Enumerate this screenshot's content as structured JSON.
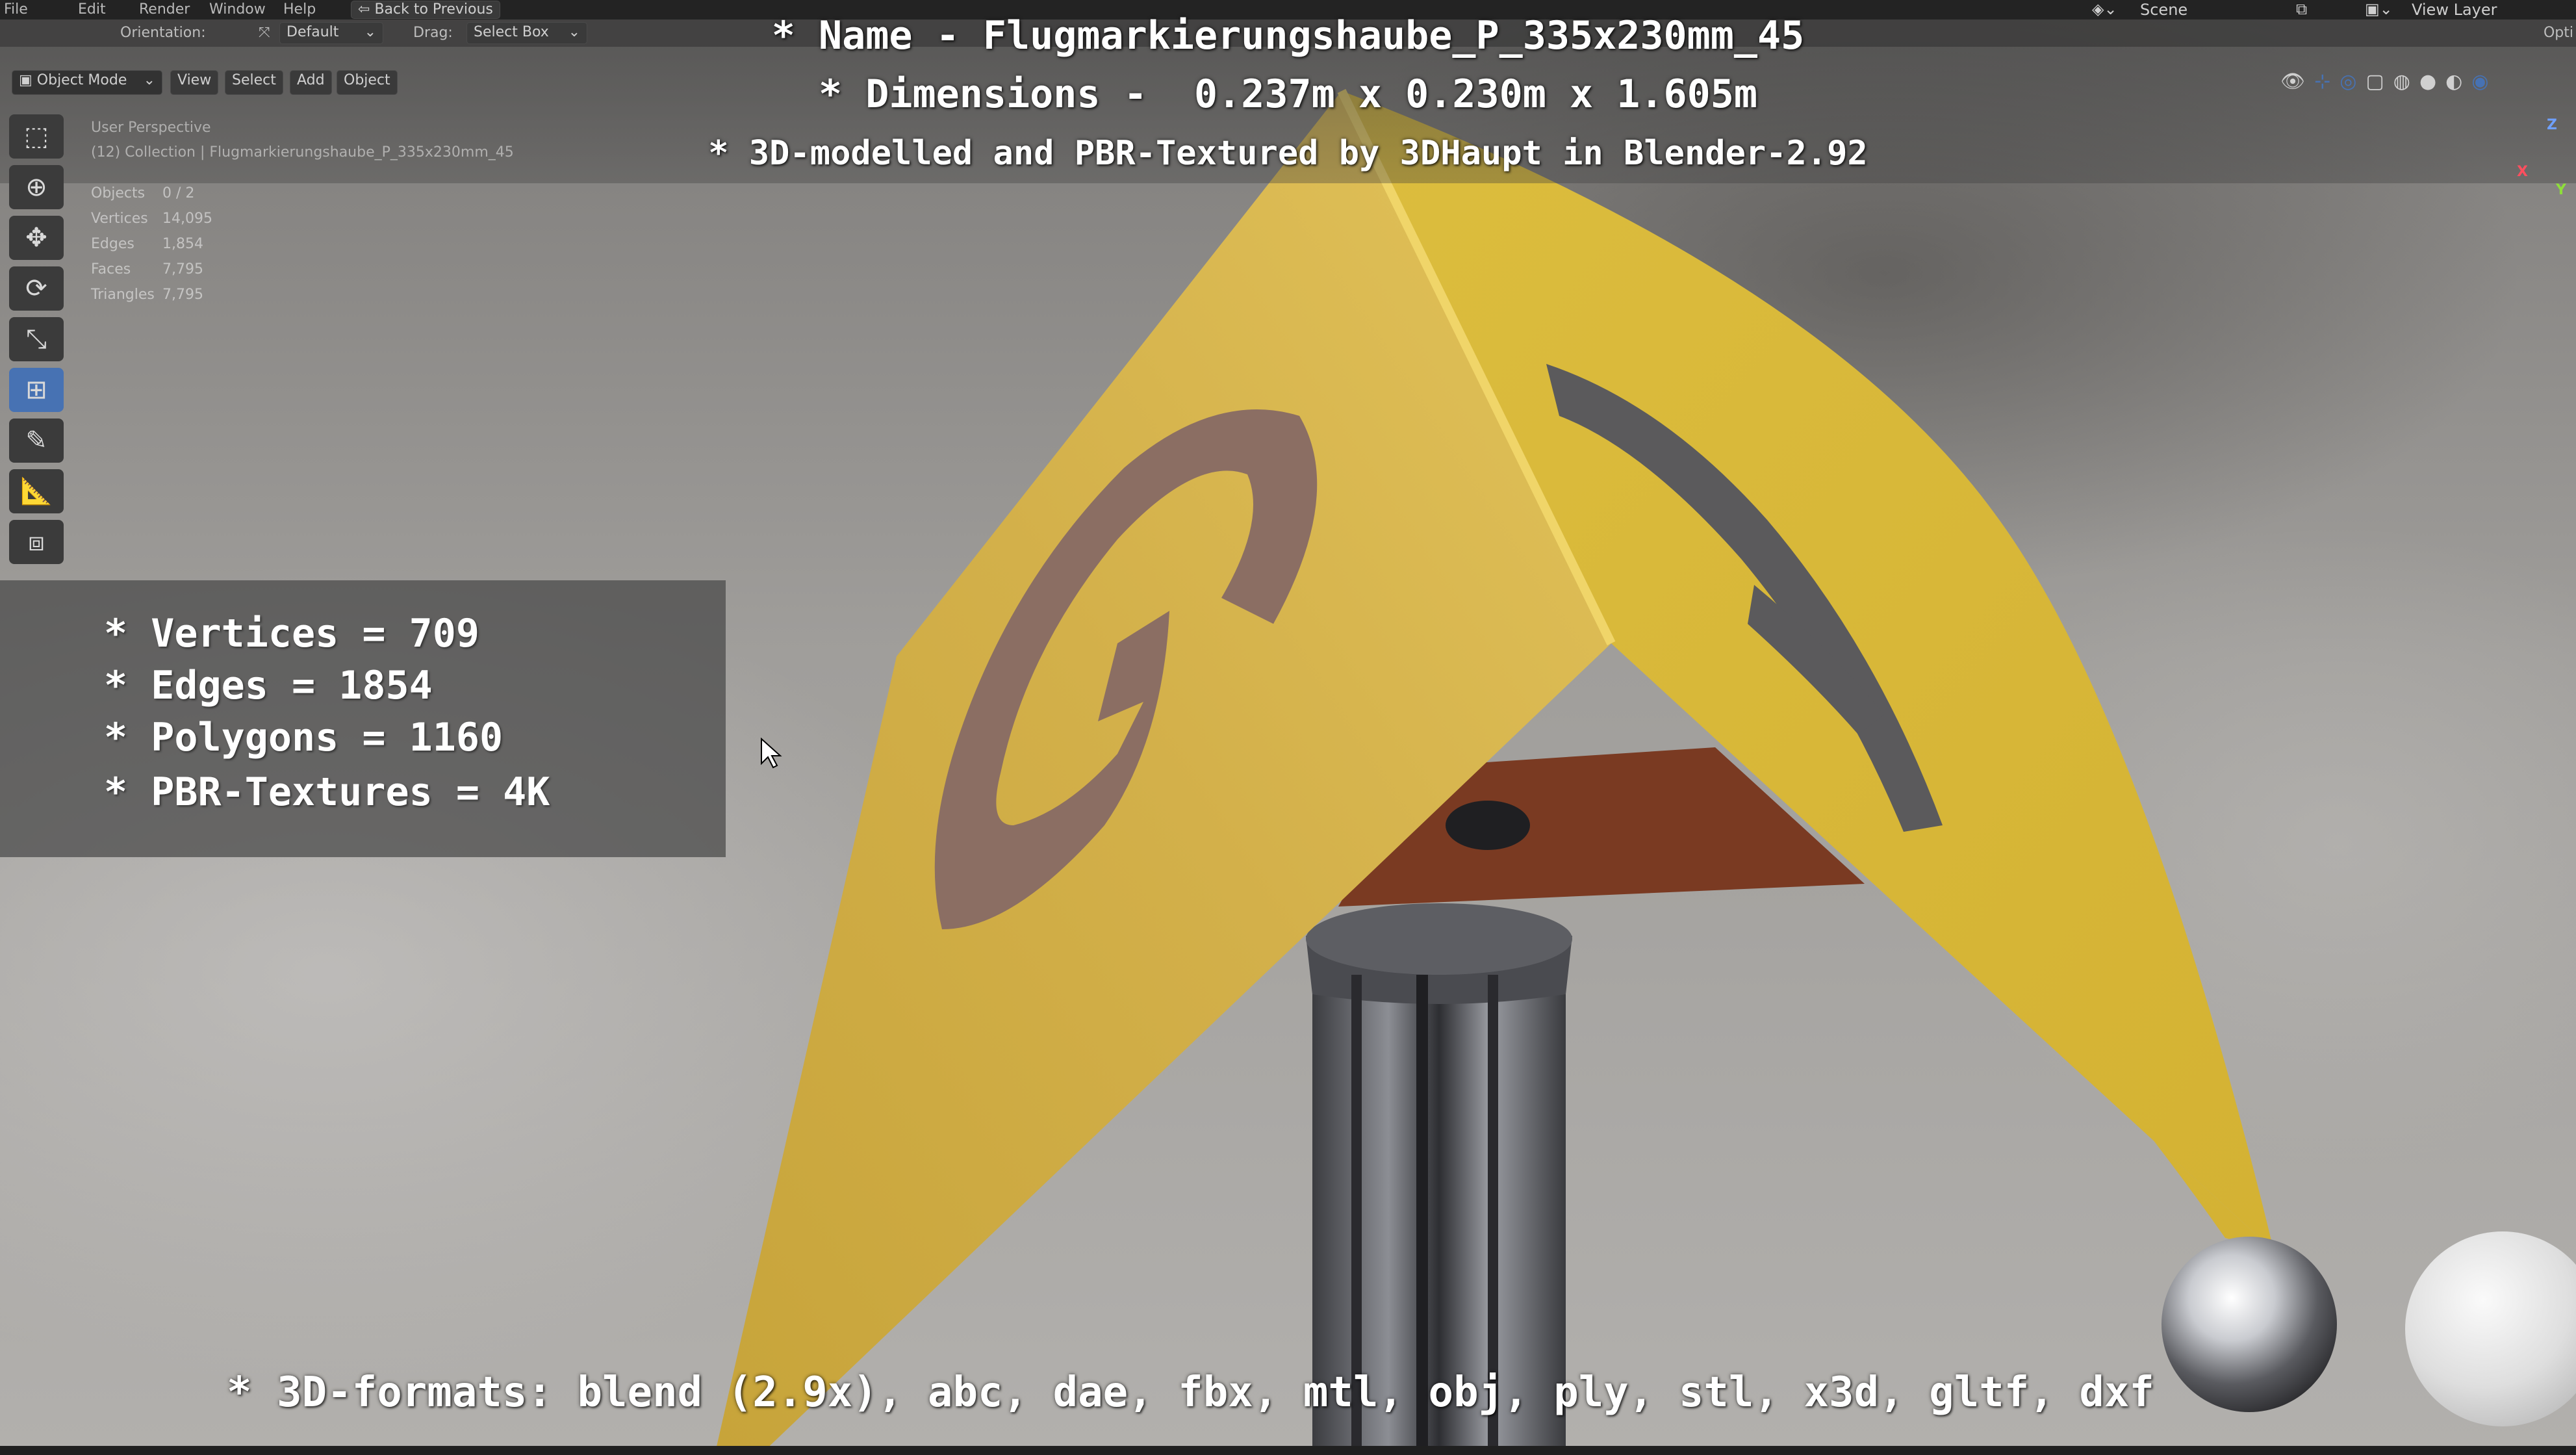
{
  "menubar": {
    "items": [
      "File",
      "Edit",
      "Render",
      "Window",
      "Help"
    ],
    "back_button": "Back to Previous",
    "scene_label": "Scene",
    "view_layer_label": "View Layer"
  },
  "header": {
    "orientation_label": "Orientation:",
    "orientation_value": "Default",
    "drag_label": "Drag:",
    "drag_value": "Select Box",
    "options_label": "Opti"
  },
  "viewport_header": {
    "mode": "Object Mode",
    "menus": [
      "View",
      "Select",
      "Add",
      "Object"
    ]
  },
  "viewport_info": {
    "perspective": "User Perspective",
    "collection": "(12) Collection | Flugmarkierungshaube_P_335x230mm_45"
  },
  "stats": [
    {
      "label": "Objects",
      "value": "0 / 2"
    },
    {
      "label": "Vertices",
      "value": "14,095"
    },
    {
      "label": "Edges",
      "value": "1,854"
    },
    {
      "label": "Faces",
      "value": "7,795"
    },
    {
      "label": "Triangles",
      "value": "7,795"
    }
  ],
  "tools": [
    "select-box",
    "cursor",
    "move",
    "rotate",
    "scale",
    "transform",
    "annotate",
    "measure",
    "add-cube"
  ],
  "captions": {
    "name": "* Name - Flugmarkierungshaube_P_335x230mm_45",
    "dimensions": "* Dimensions -  0.237m x 0.230m x 1.605m",
    "credit": "* 3D-modelled and PBR-Textured by 3DHaupt in Blender-2.92",
    "formats": "* 3D-formats: blend (2.9x), abc, dae, fbx, mtl, obj, ply, stl, x3d, gltf, dxf"
  },
  "spec_lines": [
    "* Vertices = 709",
    "* Edges = 1854",
    "* Polygons = 1160",
    "* PBR-Textures = 4K"
  ],
  "gizmo": {
    "x": "X",
    "y": "Y",
    "z": "Z"
  },
  "colors": {
    "accent": "#4772b3",
    "sign_yellow": "#d9b53a",
    "letter_brown": "#8b6e63",
    "letter_gray": "#5b5a5c"
  }
}
